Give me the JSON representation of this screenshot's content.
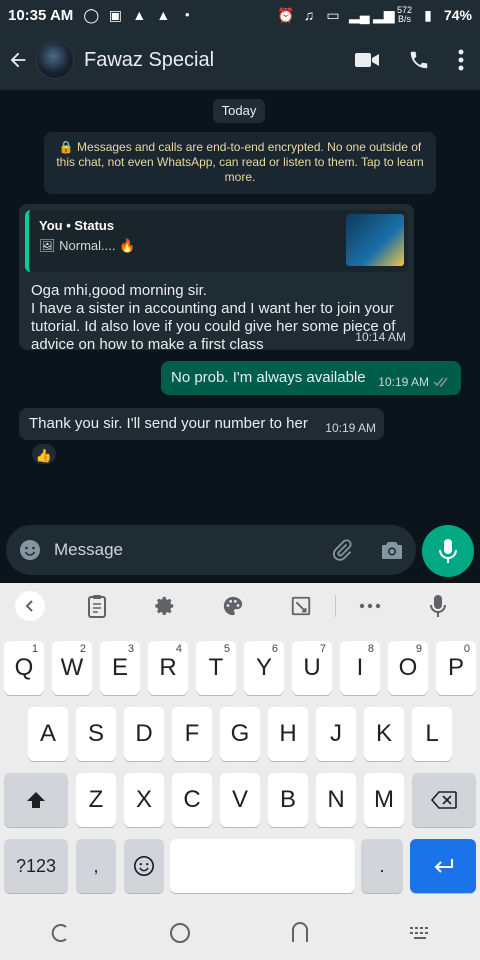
{
  "status_bar": {
    "time": "10:35 AM",
    "net_speed_value": "572",
    "net_speed_unit": "B/s",
    "battery": "74%"
  },
  "header": {
    "contact_name": "Fawaz Special",
    "icons": [
      "back-arrow-icon",
      "video-call-icon",
      "voice-call-icon",
      "more-options-icon"
    ]
  },
  "chat": {
    "date_chip": "Today",
    "encryption_notice": "🔒 Messages and calls are end-to-end encrypted. No one outside of this chat, not even WhatsApp, can read or listen to them. Tap to learn more.",
    "messages": [
      {
        "direction": "in",
        "quote_from": "You • Status",
        "quote_text": "🖼 Normal.... 🔥",
        "text": "Oga mhi,good morning sir.\nI have a sister in accounting and I want her to join your tutorial. Id also love if you could give her some piece of advice on how to make a first class",
        "time": "10:14 AM"
      },
      {
        "direction": "out",
        "text": "No prob. I'm always available",
        "time": "10:19 AM",
        "status": "read"
      },
      {
        "direction": "in",
        "text": "Thank you sir. I'll send your number to her",
        "time": "10:19 AM",
        "reaction": "👍"
      }
    ]
  },
  "composer": {
    "placeholder": "Message",
    "icons": [
      "emoji-icon",
      "attach-icon",
      "camera-icon",
      "mic-icon"
    ]
  },
  "keyboard": {
    "row1": [
      {
        "label": "Q",
        "hint": "1"
      },
      {
        "label": "W",
        "hint": "2"
      },
      {
        "label": "E",
        "hint": "3"
      },
      {
        "label": "R",
        "hint": "4"
      },
      {
        "label": "T",
        "hint": "5"
      },
      {
        "label": "Y",
        "hint": "6"
      },
      {
        "label": "U",
        "hint": "7"
      },
      {
        "label": "I",
        "hint": "8"
      },
      {
        "label": "O",
        "hint": "9"
      },
      {
        "label": "P",
        "hint": "0"
      }
    ],
    "row2": [
      "A",
      "S",
      "D",
      "F",
      "G",
      "H",
      "J",
      "K",
      "L"
    ],
    "row3": [
      "Z",
      "X",
      "C",
      "V",
      "B",
      "N",
      "M"
    ],
    "symbols_key": "?123",
    "comma_key": ",",
    "period_key": "."
  }
}
